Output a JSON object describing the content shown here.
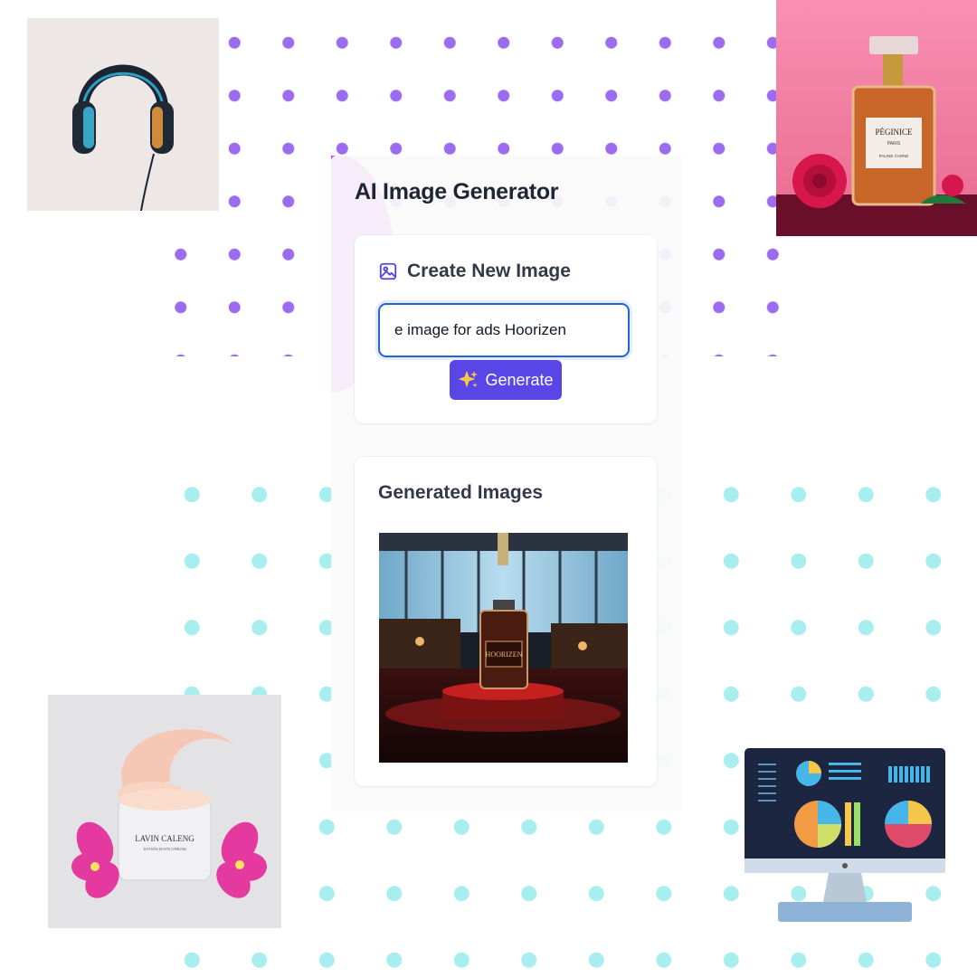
{
  "app": {
    "title": "AI Image Generator"
  },
  "create_card": {
    "heading": "Create New Image",
    "heading_icon": "image-icon",
    "prompt_value": "e image for ads Hoorizen",
    "generate_label": "Generate",
    "generate_icon": "sparkles-icon"
  },
  "results_card": {
    "heading": "Generated Images",
    "images": [
      {
        "alt": "Perfume bottle on a red pedestal in a showroom",
        "bottle_text": "HOORIZEN"
      }
    ]
  },
  "decorations": {
    "headphones": "headphones-photo",
    "perfume": {
      "label_brand": "PÉGINICE",
      "label_city": "PARIS",
      "label_line": "PALINE CARNE"
    },
    "cream": {
      "label_brand": "LAVIN CALENG",
      "label_sub": "SATION DAYN CREAM"
    },
    "monitor": "analytics-monitor-illustration"
  },
  "colors": {
    "accent": "#5a46e6",
    "input_border": "#2563d9",
    "purple_dots": "#9b6cf0",
    "teal_dots": "#a8eeee",
    "magenta": "#d63ee0"
  }
}
